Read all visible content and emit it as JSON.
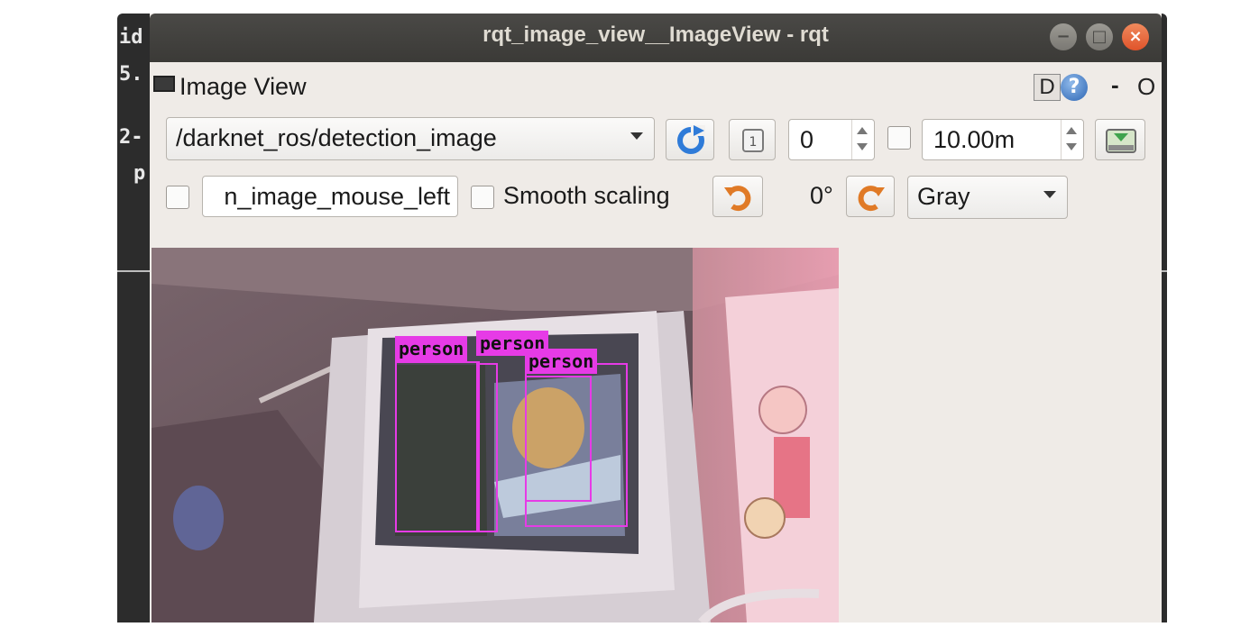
{
  "terminal": {
    "lines": [
      "id",
      "5.",
      "2-",
      "p"
    ]
  },
  "window": {
    "title": "rqt_image_view__ImageView - rqt",
    "controls": {
      "minimize": "−",
      "maximize": "□",
      "close": "×"
    }
  },
  "dock": {
    "title": "Image View",
    "d_button": "D",
    "help_button": "?",
    "minus_button": "-",
    "close_button": "O"
  },
  "toolbar": {
    "topic": "/darknet_ros/detection_image",
    "refresh_icon": "refresh-icon",
    "zoom1_icon": "zoom-original-icon",
    "spin_value": "0",
    "dynamic_range_checked": false,
    "max_range": "10.00m",
    "save_icon": "save-image-icon",
    "mouse_checked": false,
    "mouse_topic": "n_image_mouse_left",
    "smooth_checked": false,
    "smooth_label": "Smooth scaling",
    "rotate_ccw_icon": "rotate-left-icon",
    "rotation": "0°",
    "rotate_cw_icon": "rotate-right-icon",
    "color_scheme": "Gray"
  },
  "detections": [
    {
      "label": "person"
    },
    {
      "label": "person"
    },
    {
      "label": "person"
    }
  ],
  "colors": {
    "detection": "#e63be6",
    "titlebar": "#3b3a37",
    "panel": "#efebe7"
  }
}
